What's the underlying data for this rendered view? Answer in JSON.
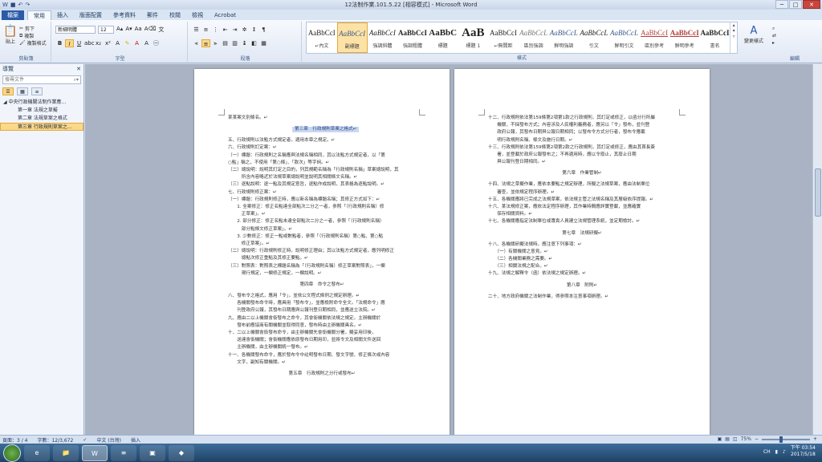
{
  "window": {
    "title": "12法制作業.101.5.22 [相容模式] - Microsoft Word",
    "controls": [
      "─",
      "□",
      "✕"
    ]
  },
  "tabs": [
    {
      "label": "檔案",
      "kind": "file"
    },
    {
      "label": "常用",
      "kind": "active"
    },
    {
      "label": "插入"
    },
    {
      "label": "版面配置"
    },
    {
      "label": "參考資料"
    },
    {
      "label": "郵件"
    },
    {
      "label": "校閱"
    },
    {
      "label": "檢視"
    },
    {
      "label": "Acrobat"
    }
  ],
  "ribbon": {
    "clipboard": {
      "label": "剪貼簿",
      "paste": "貼上",
      "cut": "剪下",
      "copy": "複製",
      "format_painter": "複製格式"
    },
    "font": {
      "label": "字型",
      "font_name": "新細明體",
      "font_size": "12"
    },
    "paragraph": {
      "label": "段落"
    },
    "styles": {
      "label": "樣式",
      "items": [
        {
          "sample": "AaBbCcI",
          "name": "↵內文"
        },
        {
          "sample": "AaBbCcI",
          "name": "副標題",
          "selected": true
        },
        {
          "sample": "AaBbCcI",
          "name": "強調斜體"
        },
        {
          "sample": "AaBbCcI",
          "name": "強調粗體"
        },
        {
          "sample": "AaBbC",
          "name": "標題"
        },
        {
          "sample": "AaB",
          "name": "標題 1"
        },
        {
          "sample": "AaBbCcI",
          "name": "↵無間距"
        },
        {
          "sample": "AaBbCcL",
          "name": "區別強調"
        },
        {
          "sample": "AaBbCcL",
          "name": "鮮明強調"
        },
        {
          "sample": "AaBbCcL",
          "name": "引文"
        },
        {
          "sample": "AaBbCcL",
          "name": "鮮明引文"
        },
        {
          "sample": "AaBbCcI",
          "name": "區別參考"
        },
        {
          "sample": "AaBbCcI",
          "name": "鮮明參考"
        },
        {
          "sample": "AaBbCcI",
          "name": "書名"
        }
      ],
      "change_styles": "變更樣式"
    },
    "editing": {
      "label": "編輯"
    }
  },
  "nav": {
    "title": "導覽",
    "search_placeholder": "搜尋文件",
    "items": [
      {
        "label": "中央行政機關法制作業應…",
        "level": 0
      },
      {
        "label": "第一章 法規之草擬",
        "level": 1
      },
      {
        "label": "第二章 法規草案之格式",
        "level": 1
      },
      {
        "label": "第三章 行政規則草案之…",
        "level": 1,
        "selected": true
      }
    ]
  },
  "page_left": [
    "某某案文別條名。↵",
    "第三章　行政規則草案之格式↵",
    "五、行政規則以法點方式規定者，適用本章之規定。↵",
    "六、行政規則訂定案：↵",
    "（一）標題：行政規則之名稱應與法規名稱相同，其以法點方式規定者，以「第",
    "○點」稱之，不使用「第○條」、「款次」等字詞。↵",
    "（二）總說明：說明其訂定之目的，列其規範名稱為「行政規則名稱」草案總說明，其",
    "　　　所含內容略近於法規草案總說明並說明其相關條文名稱。↵",
    "（三）逐點說明：逐一點及其規定意旨，逐點作成說明，其表格為逐點說明。↵",
    "七、行政規則修正案：↵",
    "（一）標題：行政規則修正時，應以新名稱為標題名稱；其修正方式如下：↵",
    "　　1. 全案修正：修正名點達全部點次二分之一者，參照「（行政規則名稱）修",
    "　　　正草案」。↵",
    "　　2. 部分修正：修正名點未達全部點次二分之一者，參照「（行政規則名稱）",
    "　　　部分點條文修正草案」。↵",
    "　　3. 少數修正：修正一點或數點者，參照「（行政規則名稱）第○點、第○點",
    "　　　修正草案」。↵",
    "（二）總說明：行政規則修正時，說明修正理由；其以法點方式規定者，應列明修正",
    "　　　總點次修正重點及其修正要點。↵",
    "（三）對照表：對照表之標題名稱為「（行政規則名稱）修正草案對照表」，一欄",
    "　　　現行規定，一欄修正規定，一欄說明。↵",
    "第四章　命令之發布↵",
    "八、發布令之格式，應用「令」，並依公文程式條例之規定辦理。↵",
    "　　各機關發布命令時，應具用「發布令」，並應檢附命令全文。「法規命令」應",
    "　　刊登政府公報，其發布日期應與公報刊登日期相同，並應送立法院。↵",
    "九、應由二以上機關會銜發布之命令，其會銜機關依法規之規定。主辦機關於",
    "　　發布前應協商有關機關並取得同意，發布時由主辦機關具名。↵",
    "十、二以上機關會銜發布命令，由主辦機關先會銜機關分署，擬妥用印後，",
    "　　送達會銜機關；會銜機關應依原發布日期用印，並將令文及相關文件送回",
    "　　主辦機關，由主辦機關統一發布。↵",
    "十一、各機關發布命令，應於發布令中註明發布日期、發文字號、修正條次或內容",
    "　　文字，副知有關機關。↵",
    "第五章　行政規則之分行或發布↵"
  ],
  "page_right": [
    "十二、行政規則依法第159條第2項第1款之行政規則，其訂定或修正，以函分行所屬",
    "　　機關，不採發布方式；內容涉及人民權利義務者，應另以「令」發布，並刊登",
    "　　政府公報，其發布日期與公報日期相同；以發布令方式分行者，發布令應載",
    "　　明行政規則名稱、條文及施行日期。↵",
    "十三、行政規則依法第159條第2項第2款之行政規則，其訂定或修正，應由其首長簽",
    "　　署，並登載於政府公報發布之；不再適用時，應以令廢止，其廢止日期",
    "　　與公報刊登日期相同。↵",
    "第六章　作業管制↵",
    "十四、法規之草擬作業，應依本要點之規定辦理，所擬之法規草案，應由法制單位",
    "　　審查，並依規定程序辦理。↵",
    "十五、各機關應將已完成之法規草案，依法規主管之法規名稱及其層級依序提報。↵",
    "十六、某法規修正案，應依法定程序辦理，其作業時間應詳實登載，並應確實",
    "　　保存相關資料。↵",
    "十七、各機關應指定法制單位或專責人員建立法規管理系統，並定期檢討。↵",
    "第七章　法規研擬↵",
    "十八、各機關研擬法規時，應注意下列事項：↵",
    "　　（一）有關機關之意見。↵",
    "　　（二）各機關業務之需要。↵",
    "　　（三）相關法規之配合。↵",
    "十九、法規之解釋令（函）依法規之規定辦理。↵",
    "第八章　附則↵",
    "二十、地方政府機關之法制作業，得參照本注意事項辦理。↵"
  ],
  "status": {
    "page": "頁面：3 / 4",
    "words": "字數：12/3,672",
    "language": "中文 (台灣)",
    "mode": "插入",
    "zoom": "75%"
  },
  "taskbar": {
    "apps": [
      "e",
      "📁",
      "W",
      "≡",
      "▣",
      "◆"
    ],
    "time": "下午 03:54",
    "date": "2017/5/18",
    "lang": "CH"
  },
  "colors": {
    "file_tab": "#2a5aa8",
    "selection": "#fbd88a",
    "taskbar": "#1f4266"
  }
}
